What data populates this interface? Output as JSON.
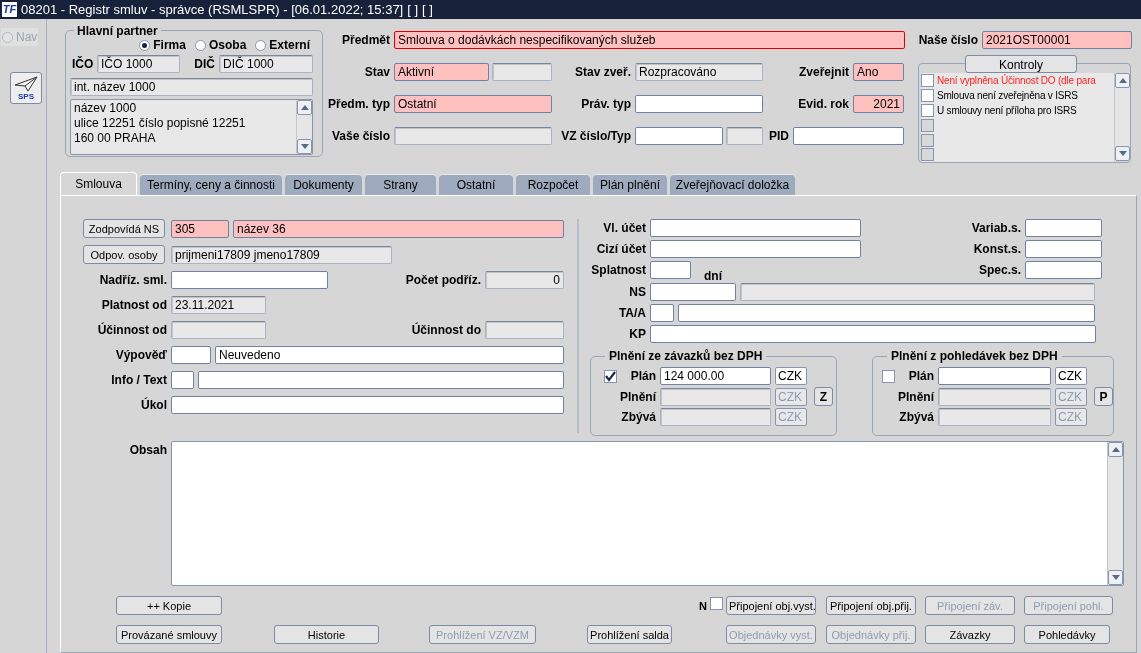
{
  "window": {
    "logo": "TF",
    "title": "08201 - Registr smluv - správce (RSMLSPR) - [06.01.2022; 15:37]",
    "title_extras": [
      "[ ]",
      "[ ]"
    ]
  },
  "nav": {
    "label": "Nav",
    "selected": false,
    "disabled": true
  },
  "sps_button": {
    "label": "SPS"
  },
  "partner": {
    "title": "Hlavní partner",
    "types": [
      {
        "label": "Firma",
        "selected": true
      },
      {
        "label": "Osoba",
        "selected": false
      },
      {
        "label": "Externí",
        "selected": false
      }
    ],
    "ico": {
      "label": "IČO",
      "value": "IČO 1000",
      "required": false,
      "readonly": true
    },
    "dic": {
      "label": "DIČ",
      "value": "DIČ 1000",
      "required": false,
      "readonly": true
    },
    "internal_name": {
      "value": "int. název 1000",
      "required": false,
      "readonly": true
    },
    "address": [
      "název 1000",
      "ulice 12251 číslo popisné 12251",
      "160 00 PRAHA"
    ]
  },
  "header": {
    "predmet": {
      "label": "Předmět",
      "value": "Smlouva o dodávkách nespecifikovaných služeb",
      "required": true,
      "readonly": false,
      "focused": true
    },
    "stav": {
      "label": "Stav",
      "value": "Aktivní",
      "required": true,
      "readonly": false
    },
    "stav_extra": {
      "required": false,
      "readonly": true
    },
    "stav_zver": {
      "label": "Stav zveř.",
      "value": "Rozpracováno",
      "required": false,
      "readonly": true
    },
    "zverejnit": {
      "label": "Zveřejnit",
      "value": "Ano",
      "required": true,
      "readonly": false
    },
    "predm_typ": {
      "label": "Předm. typ",
      "value": "Ostatní",
      "required": true,
      "readonly": false
    },
    "prav_typ": {
      "label": "Práv. typ",
      "required": false,
      "readonly": false
    },
    "evid_rok": {
      "label": "Evid. rok",
      "value": "2021",
      "required": true,
      "readonly": false
    },
    "vase_cislo": {
      "label": "Vaše číslo",
      "required": false,
      "readonly": true
    },
    "vz_cislo": {
      "label": "VZ číslo/Typ",
      "required": false,
      "readonly": false
    },
    "vz_typ": {
      "required": false,
      "readonly": true
    },
    "pid": {
      "label": "PID",
      "required": false,
      "readonly": false
    },
    "nase_cislo": {
      "label": "Naše číslo",
      "value": "2021OST00001",
      "required": true,
      "readonly": false
    }
  },
  "kontroly": {
    "button": "Kontroly",
    "items": [
      {
        "text": "Není vyplněna Účinnost DO (dle para",
        "warning": true,
        "checked": false,
        "disabled": false
      },
      {
        "text": "Smlouva není zveřejněna v ISRS",
        "warning": false,
        "checked": false,
        "disabled": false
      },
      {
        "text": "U smlouvy není příloha pro ISRS",
        "warning": false,
        "checked": false,
        "disabled": false
      },
      {
        "checked": false,
        "disabled": true
      },
      {
        "checked": false,
        "disabled": true
      },
      {
        "checked": false,
        "disabled": true
      }
    ]
  },
  "tabs": [
    {
      "label": "Smlouva",
      "selected": true
    },
    {
      "label": "Termíny, ceny a činnosti",
      "selected": false
    },
    {
      "label": "Dokumenty",
      "selected": false
    },
    {
      "label": "Strany",
      "selected": false
    },
    {
      "label": "Ostatní",
      "selected": false
    },
    {
      "label": "Rozpočet",
      "selected": false
    },
    {
      "label": "Plán plnění",
      "selected": false
    },
    {
      "label": "Zveřejňovací doložka",
      "selected": false
    }
  ],
  "smlouva": {
    "zodpovida": {
      "button": "Zodpovídá NS",
      "code": {
        "value": "305",
        "required": true,
        "readonly": false
      },
      "name": {
        "value": "název 36",
        "required": true,
        "readonly": false
      }
    },
    "odpov_osoby": {
      "button": "Odpov. osoby",
      "field": {
        "value": "prijmeni17809 jmeno17809",
        "required": false,
        "readonly": true
      }
    },
    "nadriz": {
      "label": "Nadříz. sml.",
      "required": false,
      "readonly": false
    },
    "pocet_podriz": {
      "label": "Počet podříz.",
      "value": "0",
      "required": false,
      "readonly": true
    },
    "platnost_od": {
      "label": "Platnost od",
      "value": "23.11.2021",
      "required": false,
      "readonly": true
    },
    "ucinnost_od": {
      "label": "Účinnost od",
      "required": false,
      "readonly": true
    },
    "ucinnost_do": {
      "label": "Účinnost do",
      "required": false,
      "readonly": true
    },
    "vypoved": {
      "label": "Výpověď",
      "code": {
        "required": false,
        "readonly": false
      },
      "text": {
        "value": "Neuvedeno",
        "required": false,
        "readonly": false
      }
    },
    "info_text": {
      "label": "Info / Text",
      "code": {
        "required": false,
        "readonly": false
      },
      "text": {
        "required": false,
        "readonly": false
      }
    },
    "ukol": {
      "label": "Úkol",
      "required": false,
      "readonly": false
    },
    "vl_ucet": {
      "label": "Vl. účet",
      "required": false,
      "readonly": false
    },
    "cizi_ucet": {
      "label": "Cizí účet",
      "required": false,
      "readonly": false
    },
    "splatnost": {
      "label": "Splatnost",
      "required": false,
      "readonly": false,
      "unit": "dní"
    },
    "ns": {
      "label": "NS",
      "code": {
        "required": false,
        "readonly": false
      },
      "name": {
        "required": false,
        "readonly": true
      }
    },
    "ta_a": {
      "label": "TA/A",
      "code": {
        "required": false,
        "readonly": false
      },
      "text": {
        "required": false,
        "readonly": false
      }
    },
    "kp": {
      "label": "KP",
      "required": false,
      "readonly": false
    },
    "variab": {
      "label": "Variab.s.",
      "required": false,
      "readonly": false
    },
    "konst": {
      "label": "Konst.s.",
      "required": false,
      "readonly": false
    },
    "spec": {
      "label": "Spec.s.",
      "required": false,
      "readonly": false
    },
    "plneni": [
      {
        "title": "Plnění ze závazků bez DPH",
        "checked": true,
        "button": "Z",
        "rows": [
          {
            "label": "Plán",
            "value": "124 000.00",
            "required": false,
            "readonly": false,
            "currency": "CZK",
            "currency_disabled": false
          },
          {
            "label": "Plnění",
            "required": false,
            "readonly": true,
            "currency": "CZK",
            "currency_disabled": true
          },
          {
            "label": "Zbývá",
            "required": false,
            "readonly": true,
            "currency": "CZK",
            "currency_disabled": true
          }
        ]
      },
      {
        "title": "Plnění z pohledávek bez DPH",
        "checked": false,
        "button": "P",
        "rows": [
          {
            "label": "Plán",
            "required": false,
            "readonly": false,
            "currency": "CZK",
            "currency_disabled": false
          },
          {
            "label": "Plnění",
            "required": false,
            "readonly": true,
            "currency": "CZK",
            "currency_disabled": true
          },
          {
            "label": "Zbývá",
            "required": false,
            "readonly": true,
            "currency": "CZK",
            "currency_disabled": true
          }
        ]
      }
    ],
    "obsah": {
      "label": "Obsah"
    }
  },
  "actions": {
    "row1_left": [
      {
        "label": "++ Kopie",
        "disabled": false
      }
    ],
    "n_option": {
      "label": "N",
      "checked": false
    },
    "row1_right": [
      {
        "label": "Připojení obj.vyst.",
        "disabled": false
      },
      {
        "label": "Připojení obj.přij.",
        "disabled": false
      },
      {
        "label": "Připojení záv.",
        "disabled": true
      },
      {
        "label": "Připojení pohl.",
        "disabled": true
      }
    ],
    "row2": [
      {
        "label": "Provázané smlouvy",
        "disabled": false
      },
      {
        "label": "Historie",
        "disabled": false
      },
      {
        "label": "Prohlížení VZ/VZM",
        "disabled": true
      },
      {
        "label": "Prohlížení salda",
        "disabled": false
      },
      {
        "label": "Objednávky vyst.",
        "disabled": true
      },
      {
        "label": "Objednávky přij.",
        "disabled": true
      },
      {
        "label": "Závazky",
        "disabled": false
      },
      {
        "label": "Pohledávky",
        "disabled": false
      }
    ]
  }
}
